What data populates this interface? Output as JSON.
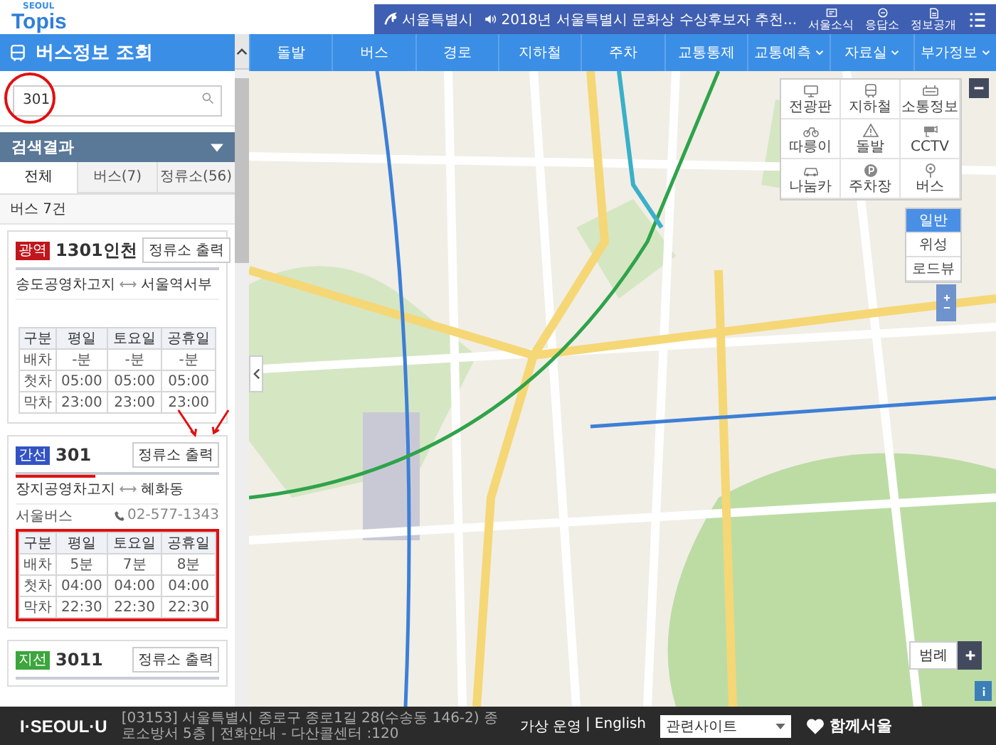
{
  "header": {
    "logo_small": "SEOUL",
    "logo": "Topis",
    "city": "서울특별시",
    "notice": "2018년 서울특별시 문화상 수상후보자 추천...",
    "links": [
      {
        "label": "서울소식"
      },
      {
        "label": "응답소"
      },
      {
        "label": "정보공개"
      }
    ]
  },
  "nav": [
    {
      "label": "돌발",
      "dropdown": false
    },
    {
      "label": "버스",
      "dropdown": false
    },
    {
      "label": "경로",
      "dropdown": false
    },
    {
      "label": "지하철",
      "dropdown": false
    },
    {
      "label": "주차",
      "dropdown": false
    },
    {
      "label": "교통통제",
      "dropdown": false
    },
    {
      "label": "교통예측",
      "dropdown": true
    },
    {
      "label": "자료실",
      "dropdown": true
    },
    {
      "label": "부가정보",
      "dropdown": true
    }
  ],
  "panel": {
    "title": "버스정보 조회",
    "search": {
      "value": "301",
      "circled": true
    },
    "results_title": "검색결과",
    "tabs": [
      {
        "label": "전체",
        "selected": true
      },
      {
        "label": "버스(7)",
        "selected": false
      },
      {
        "label": "정류소(56)",
        "selected": false
      }
    ],
    "count": "버스 7건",
    "routes": [
      {
        "type_label": "광역",
        "color": "#c0161c",
        "number": "1301인천",
        "print_button": "정류소 출력",
        "from": "송도공영차고지",
        "to": "서울역서부",
        "annotated": false,
        "columns": [
          "구분",
          "평일",
          "토요일",
          "공휴일"
        ],
        "rows": [
          [
            "배차",
            "-분",
            "-분",
            "-분"
          ],
          [
            "첫차",
            "05:00",
            "05:00",
            "05:00"
          ],
          [
            "막차",
            "23:00",
            "23:00",
            "23:00"
          ]
        ]
      },
      {
        "type_label": "간선",
        "color": "#3353c4",
        "number": "301",
        "print_button": "정류소 출력",
        "from": "장지공영차고지",
        "to": "혜화동",
        "company": "서울버스",
        "phone": "02-577-1343",
        "annotated": true,
        "columns": [
          "구분",
          "평일",
          "토요일",
          "공휴일"
        ],
        "rows": [
          [
            "배차",
            "5분",
            "7분",
            "8분"
          ],
          [
            "첫차",
            "04:00",
            "04:00",
            "04:00"
          ],
          [
            "막차",
            "22:30",
            "22:30",
            "22:30"
          ]
        ]
      },
      {
        "type_label": "지선",
        "color": "#3ca53c",
        "number": "3011",
        "print_button": "정류소 출력",
        "annotated": false
      }
    ]
  },
  "map": {
    "layers": [
      {
        "label": "전광판"
      },
      {
        "label": "지하철"
      },
      {
        "label": "소통정보"
      },
      {
        "label": "따릉이"
      },
      {
        "label": "돌발"
      },
      {
        "label": "CCTV"
      },
      {
        "label": "나눔카"
      },
      {
        "label": "주차장"
      },
      {
        "label": "버스"
      }
    ],
    "map_types": [
      {
        "label": "일반",
        "selected": true
      },
      {
        "label": "위성",
        "selected": false
      },
      {
        "label": "로드뷰",
        "selected": false
      }
    ],
    "legend": "범례"
  },
  "footer": {
    "logo": "I·SEOUL·U",
    "address": "[03153] 서울특별시 종로구 종로1길 28(수송동 146-2) 종로소방서 5층  |  전화안내 - 다산콜센터 :120",
    "link_1": "가상 운영",
    "separator": "|",
    "link_2": "English",
    "select": "관련사이트",
    "brand": "함께서울"
  }
}
